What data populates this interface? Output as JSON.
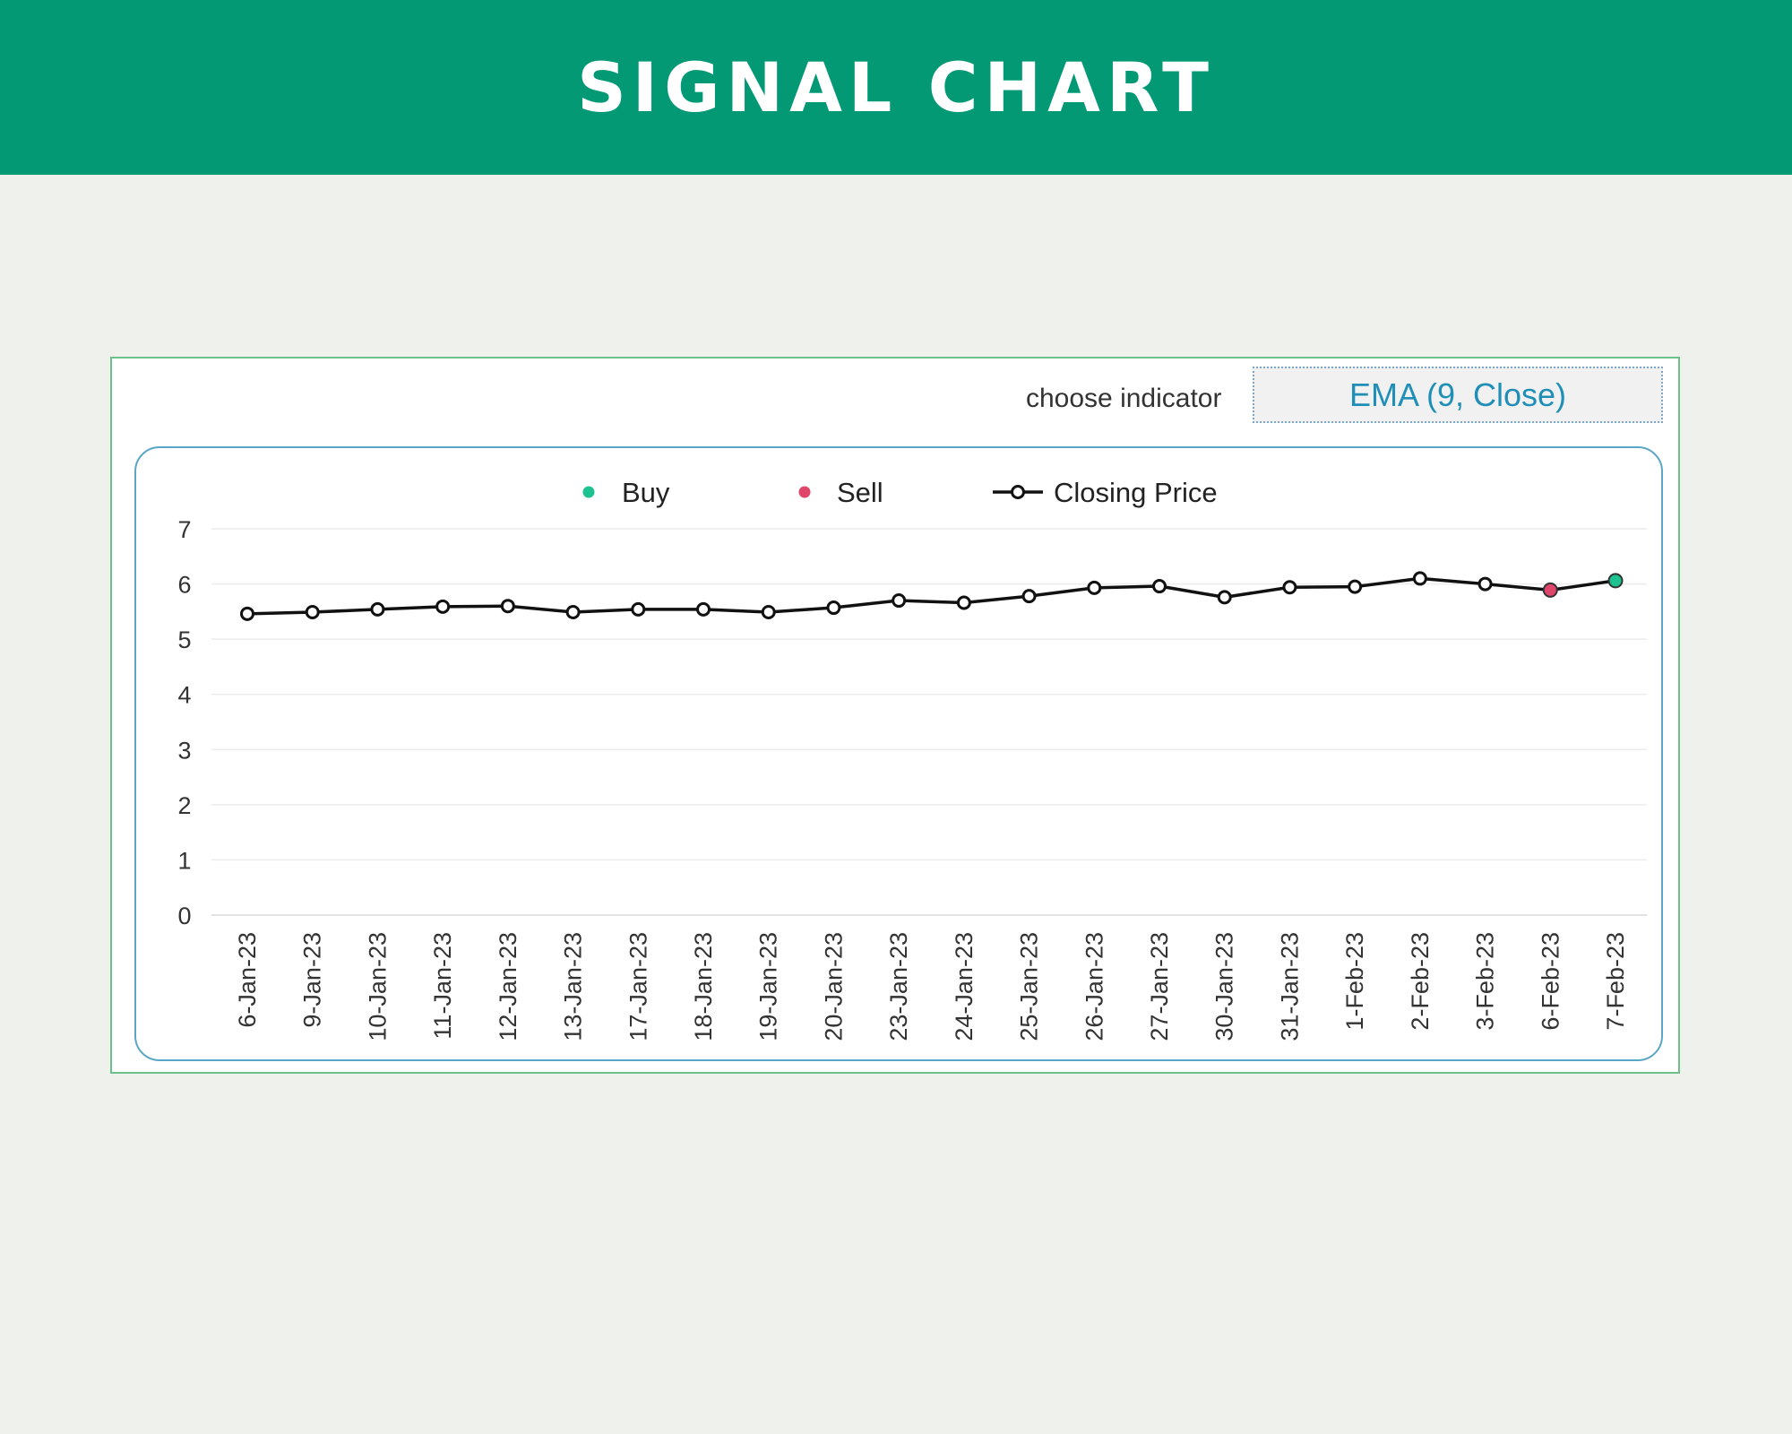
{
  "header": {
    "title": "SIGNAL CHART"
  },
  "indicator": {
    "label": "choose indicator",
    "value": "EMA (9, Close)"
  },
  "colors": {
    "banner": "#039975",
    "buy": "#1cc28f",
    "sell": "#e0456b",
    "line": "#111111"
  },
  "chart_data": {
    "type": "line",
    "title": "",
    "xlabel": "",
    "ylabel": "",
    "ylim": [
      0,
      7
    ],
    "yticks": [
      0,
      1,
      2,
      3,
      4,
      5,
      6,
      7
    ],
    "grid": true,
    "legend_position": "top",
    "legend": [
      {
        "name": "Buy",
        "marker": "dot",
        "color": "#1cc28f"
      },
      {
        "name": "Sell",
        "marker": "dot",
        "color": "#e0456b"
      },
      {
        "name": "Closing Price",
        "marker": "line-circle",
        "color": "#111111"
      }
    ],
    "categories": [
      "6-Jan-23",
      "9-Jan-23",
      "10-Jan-23",
      "11-Jan-23",
      "12-Jan-23",
      "13-Jan-23",
      "17-Jan-23",
      "18-Jan-23",
      "19-Jan-23",
      "20-Jan-23",
      "23-Jan-23",
      "24-Jan-23",
      "25-Jan-23",
      "26-Jan-23",
      "27-Jan-23",
      "30-Jan-23",
      "31-Jan-23",
      "1-Feb-23",
      "2-Feb-23",
      "3-Feb-23",
      "6-Feb-23",
      "7-Feb-23"
    ],
    "series": [
      {
        "name": "Closing Price",
        "values": [
          5.46,
          5.49,
          5.54,
          5.59,
          5.6,
          5.49,
          5.54,
          5.54,
          5.49,
          5.57,
          5.7,
          5.66,
          5.78,
          5.93,
          5.96,
          5.76,
          5.94,
          5.95,
          6.1,
          6.0,
          5.89,
          6.06
        ]
      },
      {
        "name": "Sell",
        "categories": [
          "6-Feb-23"
        ],
        "values": [
          5.89
        ]
      },
      {
        "name": "Buy",
        "categories": [
          "7-Feb-23"
        ],
        "values": [
          6.06
        ]
      }
    ]
  }
}
